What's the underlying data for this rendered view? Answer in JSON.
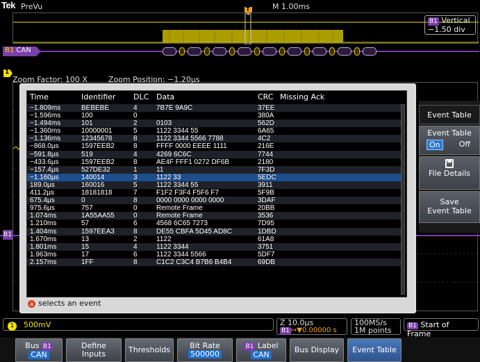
{
  "header": {
    "brand": "Tek",
    "mode": "PreVu",
    "timebase": "M 1.00ms",
    "trigger_marker": "T"
  },
  "vertical_box": {
    "badge": "B1",
    "line1": "Vertical",
    "line2": "−1.50 div"
  },
  "bus": {
    "badge": "B1",
    "label": "CAN"
  },
  "channel_marker": "1",
  "zoom": {
    "factor": "Zoom Factor: 100 X",
    "position": "Zoom Position: −1.20µs"
  },
  "event_table": {
    "columns": {
      "time": "Time",
      "identifier": "Identifier",
      "dlc": "DLC",
      "data": "Data",
      "crc": "CRC",
      "missing_ack": "Missing Ack"
    },
    "rows": [
      {
        "time": "−1.809ms",
        "id": "BEBEBE",
        "dlc": "4",
        "data": "7B7E 9A9C",
        "crc": "37EE",
        "ack": ""
      },
      {
        "time": "−1.596ms",
        "id": "100",
        "dlc": "0",
        "data": "",
        "crc": "380A",
        "ack": ""
      },
      {
        "time": "−1.494ms",
        "id": "101",
        "dlc": "2",
        "data": "0103",
        "crc": "562D",
        "ack": ""
      },
      {
        "time": "−1.360ms",
        "id": "10000001",
        "dlc": "5",
        "data": "1122 3344 55",
        "crc": "6A65",
        "ack": ""
      },
      {
        "time": "−1.136ms",
        "id": "12345678",
        "dlc": "8",
        "data": "1122 3344 5566 7788",
        "crc": "4C2",
        "ack": ""
      },
      {
        "time": "−868.0µs",
        "id": "1597EEB2",
        "dlc": "8",
        "data": "FFFF 0000 EEEE 1111",
        "crc": "216E",
        "ack": ""
      },
      {
        "time": "−591.8µs",
        "id": "519",
        "dlc": "4",
        "data": "4269 6C6C",
        "crc": "7744",
        "ack": ""
      },
      {
        "time": "−433.6µs",
        "id": "1597EEB2",
        "dlc": "8",
        "data": "AE4F FFF1 0272 DF6B",
        "crc": "2180",
        "ack": ""
      },
      {
        "time": "−157.4µs",
        "id": "527DE32",
        "dlc": "1",
        "data": "11",
        "crc": "7F3D",
        "ack": ""
      },
      {
        "time": "−1.160µs",
        "id": "140014",
        "dlc": "3",
        "data": "1122 33",
        "crc": "5EDC",
        "ack": "",
        "selected": true
      },
      {
        "time": "189.0µs",
        "id": "160016",
        "dlc": "5",
        "data": "1122 3344 55",
        "crc": "3911",
        "ack": ""
      },
      {
        "time": "411.2µs",
        "id": "18181818",
        "dlc": "7",
        "data": "F1F2 F3F4 F5F6 F7",
        "crc": "5F9B",
        "ack": ""
      },
      {
        "time": "675.4µs",
        "id": "0",
        "dlc": "8",
        "data": "0000 0000 0000 0000",
        "crc": "3DAF",
        "ack": ""
      },
      {
        "time": "975.6µs",
        "id": "757",
        "dlc": "0",
        "data": "Remote Frame",
        "crc": "20BB",
        "ack": ""
      },
      {
        "time": "1.074ms",
        "id": "1A55AA55",
        "dlc": "0",
        "data": "Remote Frame",
        "crc": "3536",
        "ack": ""
      },
      {
        "time": "1.210ms",
        "id": "57",
        "dlc": "6",
        "data": "4568 6C65 7273",
        "crc": "7D95",
        "ack": ""
      },
      {
        "time": "1.404ms",
        "id": "1597EEA3",
        "dlc": "8",
        "data": "DE55 CBFA 5D45 AD8C",
        "crc": "1DBD",
        "ack": ""
      },
      {
        "time": "1.670ms",
        "id": "13",
        "dlc": "2",
        "data": "1122",
        "crc": "61A8",
        "ack": ""
      },
      {
        "time": "1.801ms",
        "id": "15",
        "dlc": "4",
        "data": "1122 3344",
        "crc": "3751",
        "ack": ""
      },
      {
        "time": "1.963ms",
        "id": "17",
        "dlc": "6",
        "data": "1122 3344 5566",
        "crc": "5DF7",
        "ack": ""
      },
      {
        "time": "2.157ms",
        "id": "1FF",
        "dlc": "8",
        "data": "C1C2 C3C4 B7B6 B4B4",
        "crc": "69DB",
        "ack": ""
      }
    ],
    "footer_icon": "a",
    "footer_text": "selects an event"
  },
  "side_menu": {
    "title": "Event Table",
    "toggle_label": "Event Table",
    "toggle_on": "On",
    "toggle_off": "Off",
    "file_details": "File Details",
    "save_line1": "Save",
    "save_line2": "Event Table"
  },
  "status_bar": {
    "ch1_number": "1",
    "ch1_scale": "500mV",
    "horizontal_line1": "Z 10.0µs",
    "horizontal_line2": "↦▼0.00000 s",
    "horizontal_badge": "B1",
    "sample_rate": "100MS/s",
    "record_length": "1M points",
    "trigger_badge": "B1",
    "trigger_text": "Start of Frame"
  },
  "bottom_menu": {
    "bus_label": "Bus",
    "bus_badge": "B1",
    "bus_value": "CAN",
    "define_l1": "Define",
    "define_l2": "Inputs",
    "thresholds": "Thresholds",
    "bitrate_label": "Bit Rate",
    "bitrate_value": "500000",
    "label_badge": "B1",
    "label_label": "Label",
    "label_value": "CAN",
    "bus_display": "Bus Display",
    "event_table": "Event Table"
  },
  "colors": {
    "ch1": "#f2e200",
    "bus": "#7b3fa8",
    "selection": "#1f4e8c",
    "active_blue": "#2d79d4"
  }
}
